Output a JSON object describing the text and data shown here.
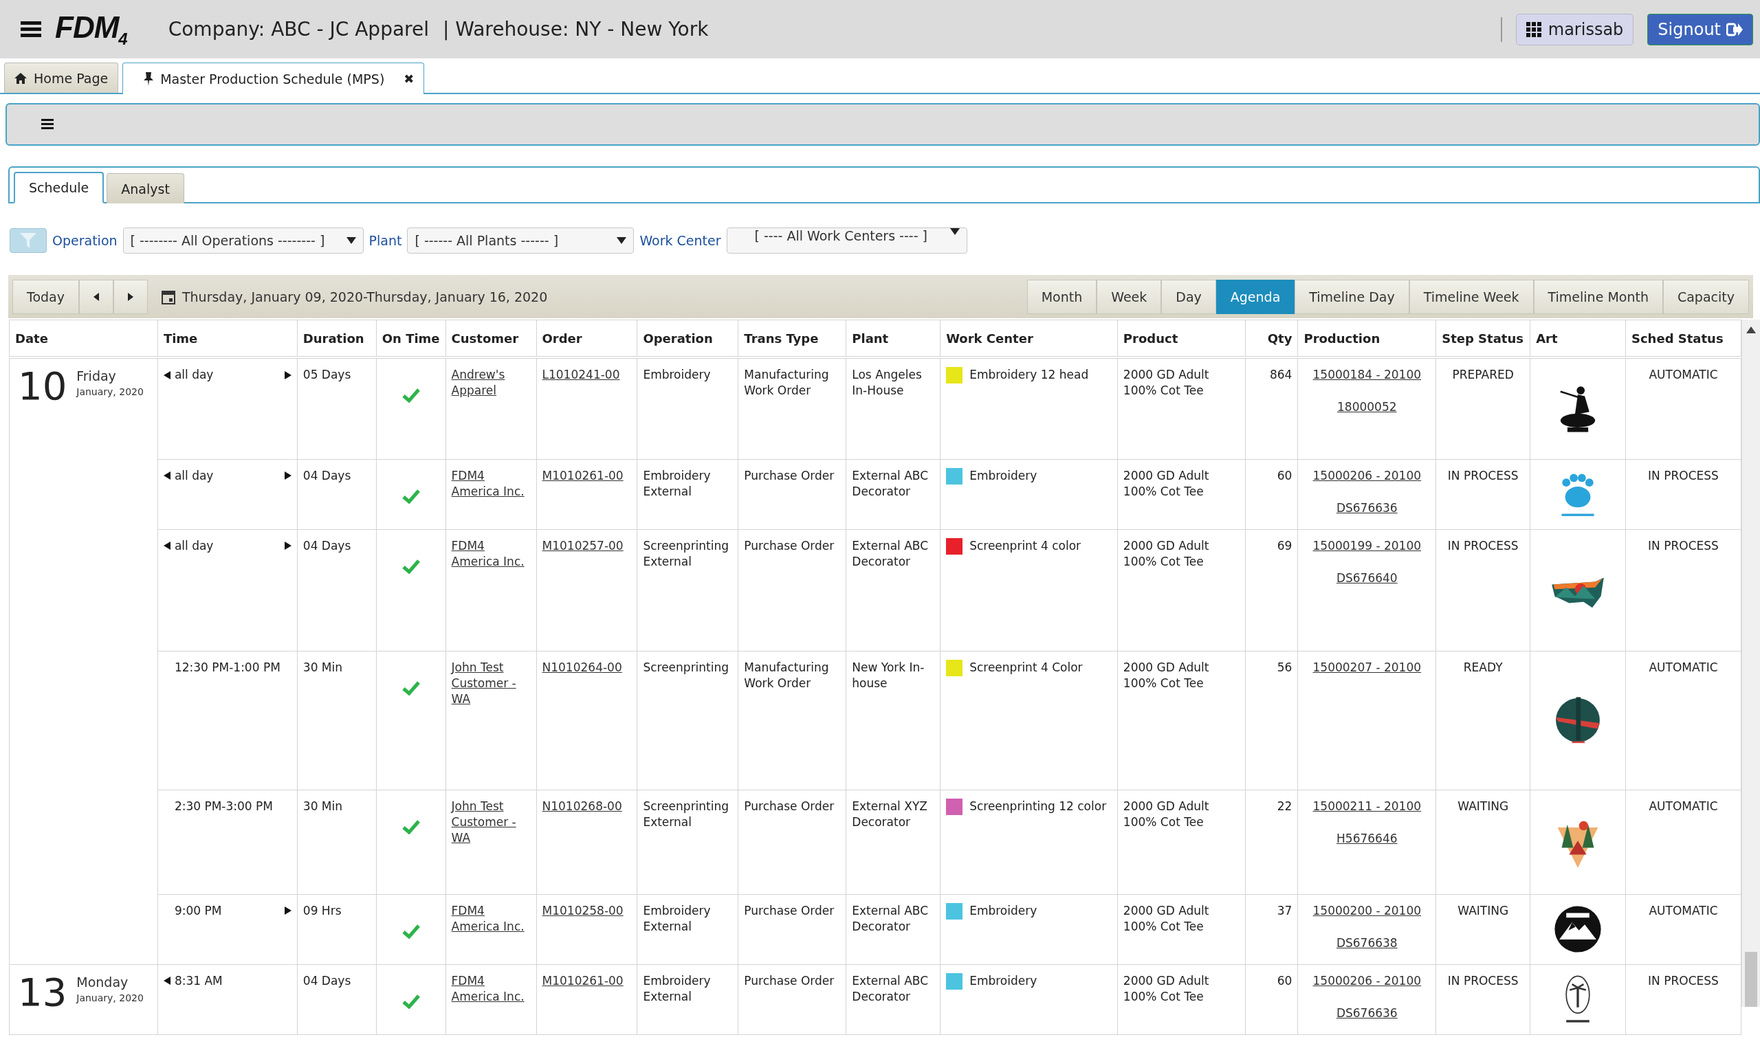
{
  "header": {
    "logo": "FDM$_{4}$",
    "company": "Company: ABC - JC Apparel",
    "warehouse": "| Warehouse: NY - New York",
    "user": "marissab",
    "signout": "Signout"
  },
  "tabs": [
    {
      "label": "Home Page",
      "kind": "home",
      "selected": false
    },
    {
      "label": "Master Production Schedule (MPS)",
      "kind": "pinned",
      "selected": true,
      "close": "✖"
    }
  ],
  "sub_tabs": [
    {
      "label": "Schedule",
      "selected": true
    },
    {
      "label": "Analyst",
      "selected": false
    }
  ],
  "filters": [
    {
      "label": "Operation",
      "value": "[ -------- All Operations -------- ]"
    },
    {
      "label": "Plant",
      "value": "[ ------ All Plants ------ ]"
    },
    {
      "label": "Work Center",
      "value": "[ ---- All Work Centers ---- ]"
    }
  ],
  "calendar": {
    "today": "Today",
    "range": "Thursday, January 09, 2020-Thursday, January 16, 2020",
    "views": [
      {
        "label": "Month",
        "selected": false
      },
      {
        "label": "Week",
        "selected": false
      },
      {
        "label": "Day",
        "selected": false
      },
      {
        "label": "Agenda",
        "selected": true
      },
      {
        "label": "Timeline Day",
        "selected": false
      },
      {
        "label": "Timeline Week",
        "selected": false
      },
      {
        "label": "Timeline Month",
        "selected": false
      },
      {
        "label": "Capacity",
        "selected": false
      }
    ]
  },
  "table": {
    "columns": [
      "Date",
      "Time",
      "Duration",
      "On Time",
      "Customer",
      "Order",
      "Operation",
      "Trans Type",
      "Plant",
      "Work Center",
      "Product",
      "Qty",
      "Production",
      "Step Status",
      "Art",
      "Sched Status"
    ],
    "days": [
      {
        "day": "10",
        "weekday": "Friday",
        "month": "January, 2020",
        "events": [
          {
            "time": "all day",
            "continues_before": true,
            "continues_after": true,
            "duration": "05 Days",
            "on_time": true,
            "customer": "Andrew's Apparel",
            "order": "L1010241-00",
            "operation": "Embroidery",
            "trans_type": "Manufacturing Work Order",
            "plant": "Los Angeles In-House",
            "work_center": "Embroidery 12 head",
            "color": "#e6e619",
            "product": "2000 GD Adult 100% Cot Tee",
            "qty": "864",
            "production": [
              "15000184 - 20100",
              "18000052"
            ],
            "step_status": "PREPARED",
            "art": {
              "kind": "picture"
            },
            "sched_status": "AUTOMATIC"
          },
          {
            "time": "all day",
            "continues_before": true,
            "continues_after": true,
            "duration": "04 Days",
            "on_time": true,
            "customer": "FDM4 America Inc.",
            "order": "M1010261-00",
            "operation": "Embroidery External",
            "trans_type": "Purchase Order",
            "plant": "External ABC Decorator",
            "work_center": "Embroidery",
            "color": "#4cc4e0",
            "product": "2000 GD Adult 100% Cot Tee",
            "qty": "60",
            "production": [
              "15000206 - 20100",
              "DS676636"
            ],
            "step_status": "IN PROCESS",
            "art": {
              "kind": "picture"
            },
            "sched_status": "IN PROCESS"
          },
          {
            "time": "all day",
            "continues_before": true,
            "continues_after": true,
            "duration": "04 Days",
            "on_time": true,
            "customer": "FDM4 America Inc.",
            "order": "M1010257-00",
            "operation": "Screenprinting External",
            "trans_type": "Purchase Order",
            "plant": "External ABC Decorator",
            "work_center": "Screenprint 4 color",
            "color": "#e8202a",
            "product": "2000 GD Adult 100% Cot Tee",
            "qty": "69",
            "production": [
              "15000199 - 20100",
              "DS676640"
            ],
            "step_status": "IN PROCESS",
            "art": {
              "kind": "picture"
            },
            "sched_status": "IN PROCESS"
          },
          {
            "time": "12:30 PM-1:00 PM",
            "continues_before": false,
            "continues_after": false,
            "duration": "30 Min",
            "on_time": true,
            "customer": "John Test Customer - WA",
            "order": "N1010264-00",
            "operation": "Screenprinting",
            "trans_type": "Manufacturing Work Order",
            "plant": "New York In-house",
            "work_center": "Screenprint 4 Color",
            "color": "#e6e619",
            "product": "2000 GD Adult 100% Cot Tee",
            "qty": "56",
            "production": [
              "15000207 - 20100"
            ],
            "step_status": "READY",
            "art": {
              "kind": "picture"
            },
            "sched_status": "AUTOMATIC"
          },
          {
            "time": "2:30 PM-3:00 PM",
            "continues_before": false,
            "continues_after": false,
            "duration": "30 Min",
            "on_time": true,
            "customer": "John Test Customer - WA",
            "order": "N1010268-00",
            "operation": "Screenprinting External",
            "trans_type": "Purchase Order",
            "plant": "External XYZ Decorator",
            "work_center": "Screenprinting 12 color",
            "color": "#d060b0",
            "product": "2000 GD Adult 100% Cot Tee",
            "qty": "22",
            "production": [
              "15000211 - 20100",
              "H5676646"
            ],
            "step_status": "WAITING",
            "art": {
              "kind": "picture"
            },
            "sched_status": "AUTOMATIC"
          },
          {
            "time": "9:00 PM",
            "continues_before": false,
            "continues_after": true,
            "duration": "09 Hrs",
            "on_time": true,
            "customer": "FDM4 America Inc.",
            "order": "M1010258-00",
            "operation": "Embroidery External",
            "trans_type": "Purchase Order",
            "plant": "External ABC Decorator",
            "work_center": "Embroidery",
            "color": "#4cc4e0",
            "product": "2000 GD Adult 100% Cot Tee",
            "qty": "37",
            "production": [
              "15000200 - 20100",
              "DS676638"
            ],
            "step_status": "WAITING",
            "art": {
              "kind": "picture"
            },
            "sched_status": "AUTOMATIC"
          }
        ]
      },
      {
        "day": "13",
        "weekday": "Monday",
        "month": "January, 2020",
        "events": [
          {
            "time": "8:31 AM",
            "continues_before": true,
            "continues_after": false,
            "duration": "04 Days",
            "on_time": true,
            "customer": "FDM4 America Inc.",
            "order": "M1010261-00",
            "operation": "Embroidery External",
            "trans_type": "Purchase Order",
            "plant": "External ABC Decorator",
            "work_center": "Embroidery",
            "color": "#4cc4e0",
            "product": "2000 GD Adult 100% Cot Tee",
            "qty": "60",
            "production": [
              "15000206 - 20100",
              "DS676636"
            ],
            "step_status": "IN PROCESS",
            "art": {
              "kind": "picture"
            },
            "sched_status": "IN PROCESS"
          }
        ]
      }
    ]
  }
}
